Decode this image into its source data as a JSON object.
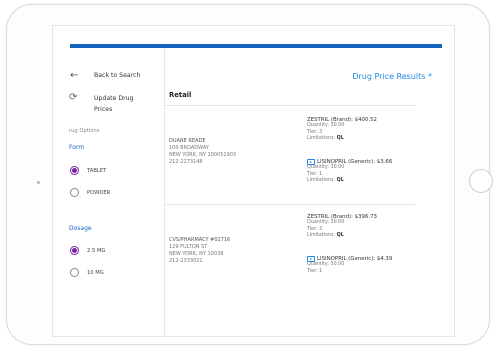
{
  "sidebar": {
    "back_label": "Back to Search",
    "update_label": "Update Drug Prices",
    "drug_options_label": "rug Options",
    "form": {
      "title": "Form",
      "options": [
        {
          "label": "TABLET",
          "selected": true
        },
        {
          "label": "POWDER",
          "selected": false
        }
      ]
    },
    "dosage": {
      "title": "Dosage",
      "options": [
        {
          "label": "2.5 MG",
          "selected": true
        },
        {
          "label": "10 MG",
          "selected": false
        }
      ]
    }
  },
  "main": {
    "title": "Drug Price Results *",
    "section": "Retail",
    "results": [
      {
        "pharmacy": {
          "name": "DUANE READE",
          "address1": "100 BROADWAY",
          "address2": "NEW YORK, NY 100051903",
          "phone": "212-2273148"
        },
        "brand": {
          "name": "ZESTRIL (Brand): $400.52",
          "quantity": "Quantity: 30.00",
          "tier": "Tier: 3",
          "limitations_label": "Limitations:",
          "limitations_value": "QL"
        },
        "generic": {
          "name": "LISINOPRIL (Generic): $3.66",
          "quantity": "Quantity: 30.00",
          "tier": "Tier: 1",
          "limitations_label": "Limitations:",
          "limitations_value": "QL"
        }
      },
      {
        "pharmacy": {
          "name": "CVS/PHARMACY #02716",
          "address1": "129 FULTON ST",
          "address2": "NEW YORK, NY 10038",
          "phone": "212-2333021"
        },
        "brand": {
          "name": "ZESTRIL (Brand): $396.73",
          "quantity": "Quantity: 30.00",
          "tier": "Tier: 3",
          "limitations_label": "Limitations:",
          "limitations_value": "QL"
        },
        "generic": {
          "name": "LISINOPRIL (Generic): $4.39",
          "quantity": "Quantity: 30.00",
          "tier": "Tier: 1"
        }
      }
    ]
  },
  "colors": {
    "accent": "#1565c0",
    "title": "#1e88e5",
    "radio_selected": "#7b1fa2"
  }
}
